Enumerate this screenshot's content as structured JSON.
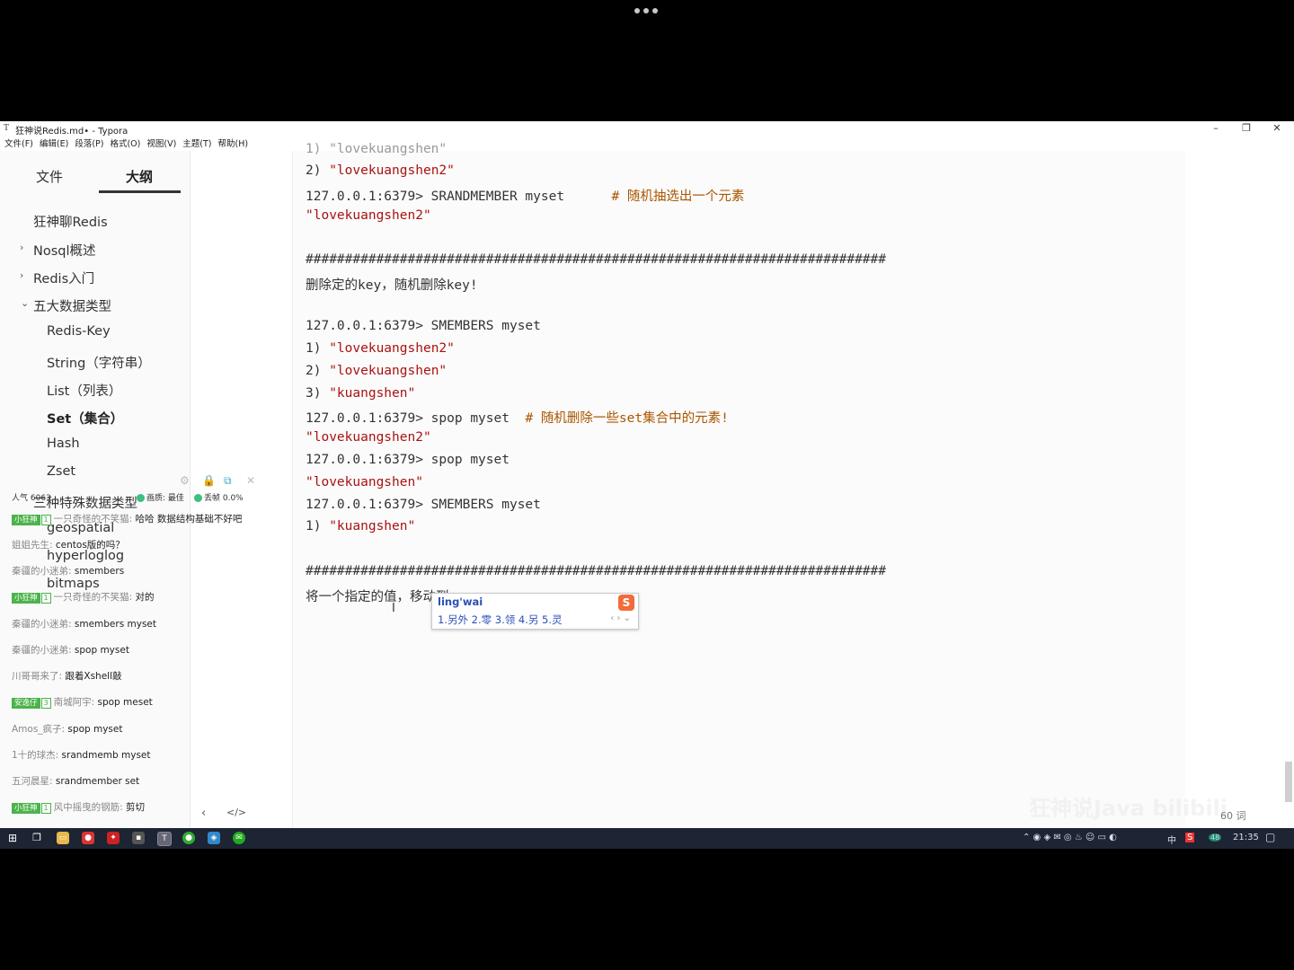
{
  "app": {
    "title": "狂神说Redis.md• - Typora",
    "menu": [
      "文件(F)",
      "编辑(E)",
      "段落(P)",
      "格式(O)",
      "视图(V)",
      "主题(T)",
      "帮助(H)"
    ]
  },
  "sidebar": {
    "tabs": {
      "file": "文件",
      "outline": "大纲"
    },
    "items": [
      {
        "label": "狂神聊Redis"
      },
      {
        "label": "Nosql概述"
      },
      {
        "label": "Redis入门"
      },
      {
        "label": "五大数据类型"
      },
      {
        "label": "Redis-Key"
      },
      {
        "label": "String（字符串）"
      },
      {
        "label": "List（列表）"
      },
      {
        "label": "Set（集合）"
      },
      {
        "label": "Hash"
      },
      {
        "label": "Zset"
      },
      {
        "label": "三种特殊数据类型"
      },
      {
        "label": "geospatial"
      },
      {
        "label": "hyperloglog"
      },
      {
        "label": "bitmaps"
      }
    ]
  },
  "editor": {
    "lines": {
      "l0": "1) \"lovekuangshen\"",
      "l1a": "2) ",
      "l1b": "\"lovekuangshen2\"",
      "l2a": "127.0.0.1:6379> SRANDMEMBER myset      ",
      "l2b": "# 随机抽选出一个元素",
      "l3": "\"lovekuangshen2\"",
      "sep": "##########################################################################",
      "l5": "删除定的key，随机删除key!",
      "l6": "127.0.0.1:6379> SMEMBERS myset",
      "l7a": "1) ",
      "l7b": "\"lovekuangshen2\"",
      "l8a": "2) ",
      "l8b": "\"lovekuangshen\"",
      "l9a": "3) ",
      "l9b": "\"kuangshen\"",
      "l10a": "127.0.0.1:6379> spop myset  ",
      "l10b": "# 随机删除一些set集合中的元素!",
      "l11": "\"lovekuangshen2\"",
      "l12": "127.0.0.1:6379> spop myset",
      "l13": "\"lovekuangshen\"",
      "l14": "127.0.0.1:6379> SMEMBERS myset",
      "l15a": "1) ",
      "l15b": "\"kuangshen\"",
      "l17": "将一个指定的值，移动到"
    }
  },
  "ime": {
    "composition": "ling'wai",
    "candidates": "1.另外  2.零  3.领  4.另  5.灵",
    "logo": "S"
  },
  "chat": {
    "stats": {
      "pop": "人气",
      "pop_val": "6063",
      "quality": "画质: 最佳",
      "drop": "丢帧 0.0%"
    },
    "messages": [
      {
        "badge": "小狂神",
        "lv": "1",
        "name": "一只奇怪的不笑猫:",
        "text": " 哈哈 数据结构基础不好吧"
      },
      {
        "name": "姐姐先生:",
        "text": " centos版的吗？"
      },
      {
        "name": "秦疆的小迷弟:",
        "text": " smembers"
      },
      {
        "badge": "小狂神",
        "lv": "1",
        "name": "一只奇怪的不笑猫:",
        "text": " 对的"
      },
      {
        "name": "秦疆的小迷弟:",
        "text": " smembers myset"
      },
      {
        "name": "秦疆的小迷弟:",
        "text": " spop myset"
      },
      {
        "name": "川哥哥来了:",
        "text": " 跟着Xshell敲"
      },
      {
        "badge": "安逸仔",
        "lv": "3",
        "name": "南城阿宇:",
        "text": " spop meset"
      },
      {
        "name": "Amos_疯子:",
        "text": " spop myset"
      },
      {
        "name": "1十的球杰:",
        "text": " srandmemb myset"
      },
      {
        "name": "五河晨星:",
        "text": " srandmember set"
      },
      {
        "badge": "小狂神",
        "lv": "1",
        "name": "风中摇曳的钢筋:",
        "text": " 剪切"
      }
    ]
  },
  "footer": {
    "wordcount": "60 词"
  },
  "watermark": "狂神说Java  bilibili",
  "taskbar": {
    "time": "21:35",
    "ime": "中",
    "badge": "48"
  }
}
